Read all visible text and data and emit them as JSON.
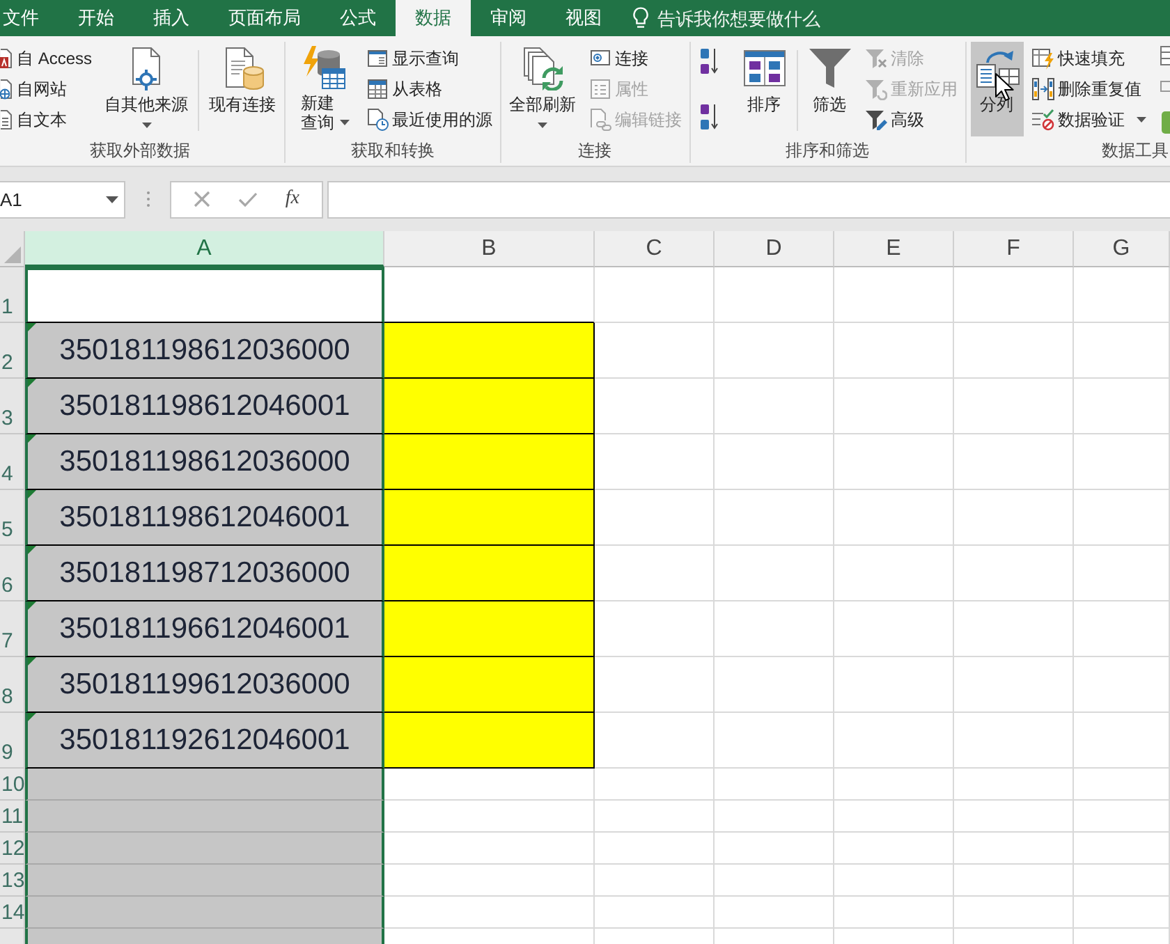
{
  "tabs": [
    {
      "label": "文件",
      "selected": false
    },
    {
      "label": "开始",
      "selected": false
    },
    {
      "label": "插入",
      "selected": false
    },
    {
      "label": "页面布局",
      "selected": false
    },
    {
      "label": "公式",
      "selected": false
    },
    {
      "label": "数据",
      "selected": true
    },
    {
      "label": "审阅",
      "selected": false
    },
    {
      "label": "视图",
      "selected": false
    }
  ],
  "tell_me": {
    "placeholder": "告诉我你想要做什么"
  },
  "ribbon": {
    "groups": [
      {
        "label": "获取外部数据",
        "columns": [
          {
            "kind": "stack",
            "items": [
              {
                "label": "自 Access",
                "disabled": false,
                "dropdown": false
              },
              {
                "label": "自网站",
                "disabled": false,
                "dropdown": false
              },
              {
                "label": "自文本",
                "disabled": false,
                "dropdown": false
              }
            ]
          },
          {
            "kind": "large",
            "items": [
              {
                "label": "自其他来源",
                "dropdown": true,
                "hovered": false
              }
            ]
          },
          {
            "kind": "divider"
          },
          {
            "kind": "large",
            "items": [
              {
                "label": "现有连接",
                "dropdown": false,
                "hovered": false
              }
            ]
          }
        ]
      },
      {
        "label": "获取和转换",
        "columns": [
          {
            "kind": "stacked",
            "items": [
              {
                "label": "新建查询",
                "dropdown": true,
                "hovered": false
              }
            ]
          },
          {
            "kind": "stack",
            "items": [
              {
                "label": "显示查询",
                "disabled": false,
                "dropdown": false
              },
              {
                "label": "从表格",
                "disabled": false,
                "dropdown": false
              },
              {
                "label": "最近使用的源",
                "disabled": false,
                "dropdown": false
              }
            ]
          }
        ]
      },
      {
        "label": "连接",
        "columns": [
          {
            "kind": "large",
            "items": [
              {
                "label": "全部刷新",
                "dropdown": true,
                "hovered": false
              }
            ]
          },
          {
            "kind": "stack",
            "items": [
              {
                "label": "连接",
                "disabled": false,
                "dropdown": false
              },
              {
                "label": "属性",
                "disabled": true,
                "dropdown": false
              },
              {
                "label": "编辑链接",
                "disabled": true,
                "dropdown": false
              }
            ]
          }
        ]
      },
      {
        "label": "排序和筛选",
        "columns": [
          {
            "kind": "sort"
          },
          {
            "kind": "large",
            "items": [
              {
                "label": "排序",
                "dropdown": false,
                "hovered": false
              }
            ]
          },
          {
            "kind": "divider"
          },
          {
            "kind": "large",
            "items": [
              {
                "label": "筛选",
                "dropdown": false,
                "hovered": false
              }
            ]
          },
          {
            "kind": "stack",
            "items": [
              {
                "label": "清除",
                "disabled": true,
                "dropdown": false
              },
              {
                "label": "重新应用",
                "disabled": true,
                "dropdown": false
              },
              {
                "label": "高级",
                "disabled": false,
                "dropdown": false
              }
            ]
          }
        ]
      },
      {
        "label": "数据工具",
        "columns": [
          {
            "kind": "large",
            "items": [
              {
                "label": "分列",
                "dropdown": false,
                "hovered": true
              }
            ]
          },
          {
            "kind": "stack",
            "items": [
              {
                "label": "快速填充",
                "disabled": false,
                "dropdown": false
              },
              {
                "label": "删除重复值",
                "disabled": false,
                "dropdown": false
              },
              {
                "label": "数据验证",
                "disabled": false,
                "dropdown": true
              }
            ]
          },
          {
            "kind": "partial"
          }
        ]
      }
    ]
  },
  "formula_bar": {
    "name_box": "A1",
    "function_label": "fx"
  },
  "sheet": {
    "columns": [
      {
        "label": "A",
        "selected": true
      },
      {
        "label": "B",
        "selected": false
      },
      {
        "label": "C",
        "selected": false
      },
      {
        "label": "D",
        "selected": false
      },
      {
        "label": "E",
        "selected": false
      },
      {
        "label": "F",
        "selected": false
      },
      {
        "label": "G",
        "selected": false
      }
    ],
    "rows": [
      {
        "header": "1",
        "active": true,
        "flagged": false,
        "bordered": false,
        "highlighted": false
      },
      {
        "header": "2",
        "value": "350181198612036000",
        "active": false,
        "flagged": true,
        "bordered": true,
        "highlighted": true
      },
      {
        "header": "3",
        "value": "350181198612046001",
        "active": false,
        "flagged": true,
        "bordered": true,
        "highlighted": true
      },
      {
        "header": "4",
        "value": "350181198612036000",
        "active": false,
        "flagged": true,
        "bordered": true,
        "highlighted": true
      },
      {
        "header": "5",
        "value": "350181198612046001",
        "active": false,
        "flagged": true,
        "bordered": true,
        "highlighted": true
      },
      {
        "header": "6",
        "value": "350181198712036000",
        "active": false,
        "flagged": true,
        "bordered": true,
        "highlighted": true
      },
      {
        "header": "7",
        "value": "350181196612046001",
        "active": false,
        "flagged": true,
        "bordered": true,
        "highlighted": true
      },
      {
        "header": "8",
        "value": "350181199612036000",
        "active": false,
        "flagged": true,
        "bordered": true,
        "highlighted": true
      },
      {
        "header": "9",
        "value": "350181192612046001",
        "active": false,
        "flagged": true,
        "bordered": true,
        "highlighted": true
      },
      {
        "header": "10",
        "active": false,
        "flagged": false,
        "bordered": false,
        "highlighted": false
      },
      {
        "header": "11",
        "active": false,
        "flagged": false,
        "bordered": false,
        "highlighted": false
      },
      {
        "header": "12",
        "active": false,
        "flagged": false,
        "bordered": false,
        "highlighted": false
      },
      {
        "header": "13",
        "active": false,
        "flagged": false,
        "bordered": false,
        "highlighted": false
      },
      {
        "header": "14",
        "active": false,
        "flagged": false,
        "bordered": false,
        "highlighted": false
      }
    ]
  }
}
